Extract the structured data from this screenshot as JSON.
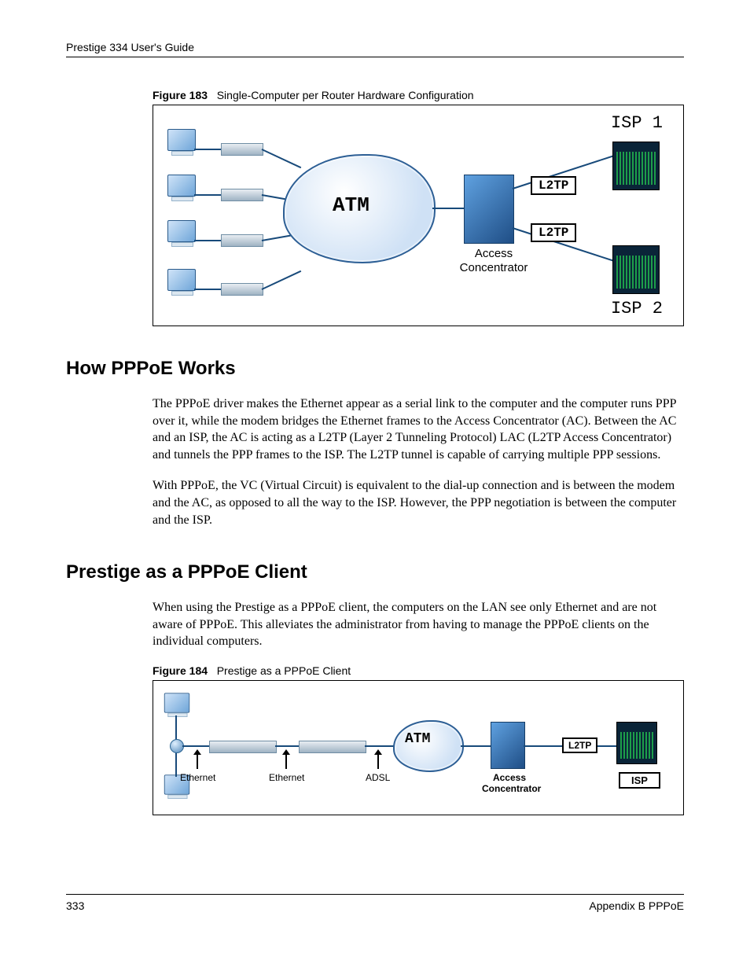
{
  "header": {
    "running_title": "Prestige 334 User's Guide"
  },
  "figure183": {
    "caption_label": "Figure 183",
    "caption_text": "Single-Computer per Router Hardware Configuration",
    "cloud_label": "ATM",
    "ac_label_line1": "Access",
    "ac_label_line2": "Concentrator",
    "l2tp_label_a": "L2TP",
    "l2tp_label_b": "L2TP",
    "isp1_label": "ISP 1",
    "isp2_label": "ISP 2"
  },
  "section1": {
    "heading": "How PPPoE Works",
    "para1": "The PPPoE driver makes the Ethernet appear as a serial link to the computer and the computer runs PPP over it, while the modem bridges the Ethernet frames to the Access Concentrator (AC).  Between the AC and an ISP, the AC is acting as a L2TP (Layer 2 Tunneling Protocol) LAC (L2TP Access Concentrator) and tunnels the PPP frames to the ISP.  The L2TP tunnel is capable of carrying multiple PPP sessions.",
    "para2": "With PPPoE, the VC (Virtual Circuit) is equivalent to the dial-up connection and is between the modem and the AC, as opposed to all the way to the ISP.  However, the PPP negotiation is between the computer and the ISP."
  },
  "section2": {
    "heading": "Prestige as a PPPoE Client",
    "para1": "When using the Prestige as a PPPoE client, the computers on the LAN see only Ethernet and are not aware of PPPoE.  This alleviates the administrator from having to manage the PPPoE clients on the individual computers."
  },
  "figure184": {
    "caption_label": "Figure 184",
    "caption_text": "Prestige as a PPPoE Client",
    "ethernet_label_a": "Ethernet",
    "ethernet_label_b": "Ethernet",
    "adsl_label": "ADSL",
    "cloud_label": "ATM",
    "ac_label_line1": "Access",
    "ac_label_line2": "Concentrator",
    "l2tp_label": "L2TP",
    "isp_label": "ISP"
  },
  "footer": {
    "page_number": "333",
    "section_ref": "Appendix B PPPoE"
  }
}
